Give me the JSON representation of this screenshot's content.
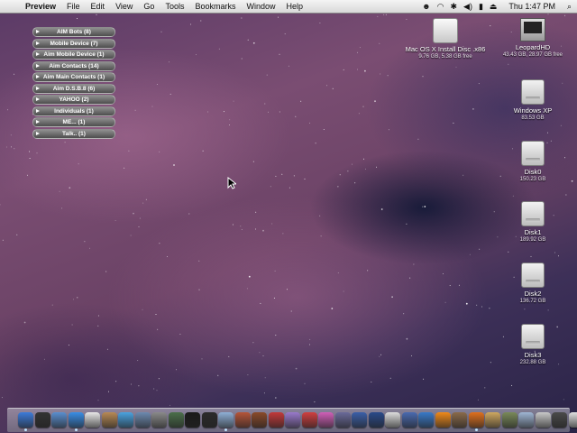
{
  "menubar": {
    "apple": "",
    "app_name": "Preview",
    "menus": [
      "File",
      "Edit",
      "View",
      "Go",
      "Tools",
      "Bookmarks",
      "Window",
      "Help"
    ],
    "clock": "Thu 1:47 PM",
    "status_icons": [
      "antivirus-icon",
      "wifi-icon",
      "bluetooth-icon",
      "volume-icon",
      "battery-icon",
      "eject-icon",
      "spotlight-icon"
    ]
  },
  "buddy_groups": [
    "AIM Bots (8)",
    "Mobile Device (7)",
    "Aim Mobile Device (1)",
    "Aim Contacts (14)",
    "Aim Main Contacts (1)",
    "Aim D.S.B.8 (6)",
    "YAHOO (2)",
    "Individuals (1)",
    "ME... (1)",
    "Talk.. (1)"
  ],
  "desktop_icons": {
    "install_disc": {
      "name": "Mac OS X Install Disc .x86",
      "sub": "9.76 GB, 5.38 GB free"
    },
    "leopardhd": {
      "name": "LeopardHD",
      "sub": "43.43 GB, 28.97 GB free"
    },
    "windowsxp": {
      "name": "Windows XP",
      "sub": "83.53 GB"
    },
    "disk0": {
      "name": "Disk0",
      "sub": "150.23 GB"
    },
    "disk1": {
      "name": "Disk1",
      "sub": "189.92 GB"
    },
    "disk2": {
      "name": "Disk2",
      "sub": "136.72 GB"
    },
    "disk3": {
      "name": "Disk3",
      "sub": "232.88 GB"
    }
  },
  "dock": {
    "items": [
      {
        "name": "finder-icon",
        "color": "#3d7bd9",
        "running": true
      },
      {
        "name": "dashboard-icon",
        "color": "#333333",
        "running": false
      },
      {
        "name": "mail-icon",
        "color": "#5a8fcf",
        "running": false
      },
      {
        "name": "safari-icon",
        "color": "#3a8ee6",
        "running": true
      },
      {
        "name": "ical-icon",
        "color": "#e8e8e8",
        "running": false
      },
      {
        "name": "address-book-icon",
        "color": "#b88a55",
        "running": false
      },
      {
        "name": "itunes-icon",
        "color": "#4aa3e0",
        "running": false
      },
      {
        "name": "photo-icon",
        "color": "#6d8ab0",
        "running": false
      },
      {
        "name": "system-prefs-icon",
        "color": "#8a8a8a",
        "running": false
      },
      {
        "name": "time-machine-icon",
        "color": "#4b6f4b",
        "running": false
      },
      {
        "name": "terminal-icon",
        "color": "#1a1a1a",
        "running": false
      },
      {
        "name": "activity-monitor-icon",
        "color": "#2b2b2b",
        "running": false
      },
      {
        "name": "preview-icon",
        "color": "#8fb0d6",
        "running": true
      },
      {
        "name": "firewire-icon",
        "color": "#b5553a",
        "running": false
      },
      {
        "name": "chess-icon",
        "color": "#8a4a2a",
        "running": false
      },
      {
        "name": "ball-icon",
        "color": "#c23a3a",
        "running": false
      },
      {
        "name": "app-icon-1",
        "color": "#9a7acc",
        "running": false
      },
      {
        "name": "magnet-icon",
        "color": "#d04040",
        "running": false
      },
      {
        "name": "flower-icon",
        "color": "#d05fb8",
        "running": false
      },
      {
        "name": "app-icon-2",
        "color": "#6a6a9a",
        "running": false
      },
      {
        "name": "network-icon",
        "color": "#3b5fa8",
        "running": false
      },
      {
        "name": "app-icon-3",
        "color": "#2a4a8a",
        "running": false
      },
      {
        "name": "keyboard-icon",
        "color": "#dddddd",
        "running": false
      },
      {
        "name": "app-icon-4",
        "color": "#4a6ab0",
        "running": false
      },
      {
        "name": "app-icon-5",
        "color": "#3a7ac8",
        "running": false
      },
      {
        "name": "vlc-icon",
        "color": "#f08a1a",
        "running": false
      },
      {
        "name": "app-icon-6",
        "color": "#8a6a4a",
        "running": false
      },
      {
        "name": "firefox-icon",
        "color": "#e0701e",
        "running": true
      },
      {
        "name": "app-icon-7",
        "color": "#cfa860",
        "running": false
      },
      {
        "name": "app-icon-8",
        "color": "#7a8a5a",
        "running": false
      },
      {
        "name": "folder-icon",
        "color": "#9fb6d4",
        "running": false
      },
      {
        "name": "app-icon-9",
        "color": "#c8c8c8",
        "running": false
      },
      {
        "name": "app-icon-10",
        "color": "#4a4a4a",
        "running": false
      },
      {
        "name": "mail-stack-icon",
        "color": "#e0e0e0",
        "running": false
      },
      {
        "name": "trash-icon",
        "color": "#9aa0a8",
        "running": false
      }
    ]
  }
}
